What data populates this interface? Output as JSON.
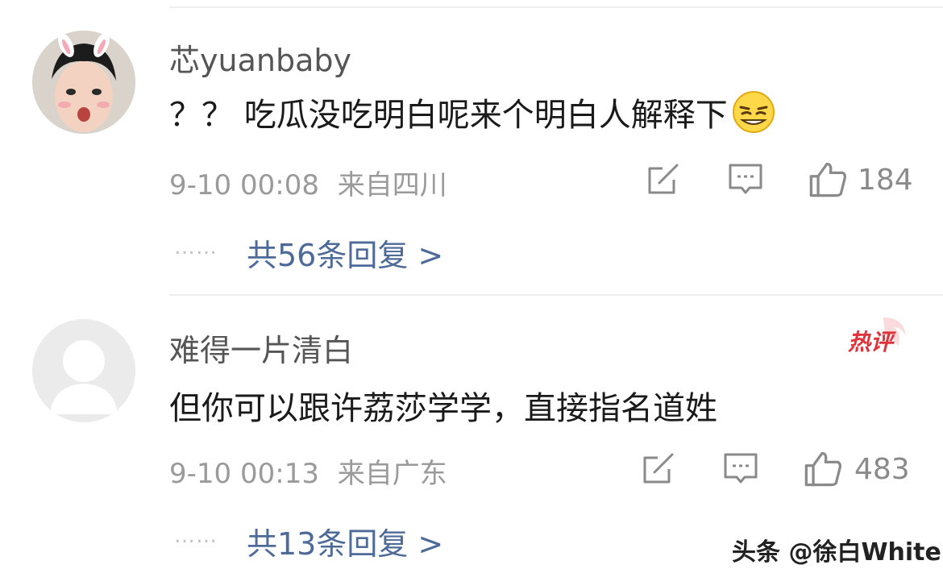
{
  "comments": [
    {
      "username": "芯yuanbaby",
      "text": "？？ 吃瓜没吃明白呢来个明白人解释下",
      "emoji": "smirk-emoji",
      "timestamp": "9-10 00:08",
      "location": "来自四川",
      "likes": "184",
      "replies_label": "共56条回复 >",
      "hot": false
    },
    {
      "username": "难得一片清白",
      "text": "但你可以跟许荔莎学学，直接指名道姓",
      "timestamp": "9-10 00:13",
      "location": "来自广东",
      "likes": "483",
      "replies_label": "共13条回复 >",
      "hot": true,
      "hot_label": "热评"
    }
  ],
  "dots": "……",
  "watermark": "头条 @徐白White",
  "colors": {
    "link": "#4e6a99",
    "meta": "#9a9a9a",
    "hot": "#e0323a"
  }
}
